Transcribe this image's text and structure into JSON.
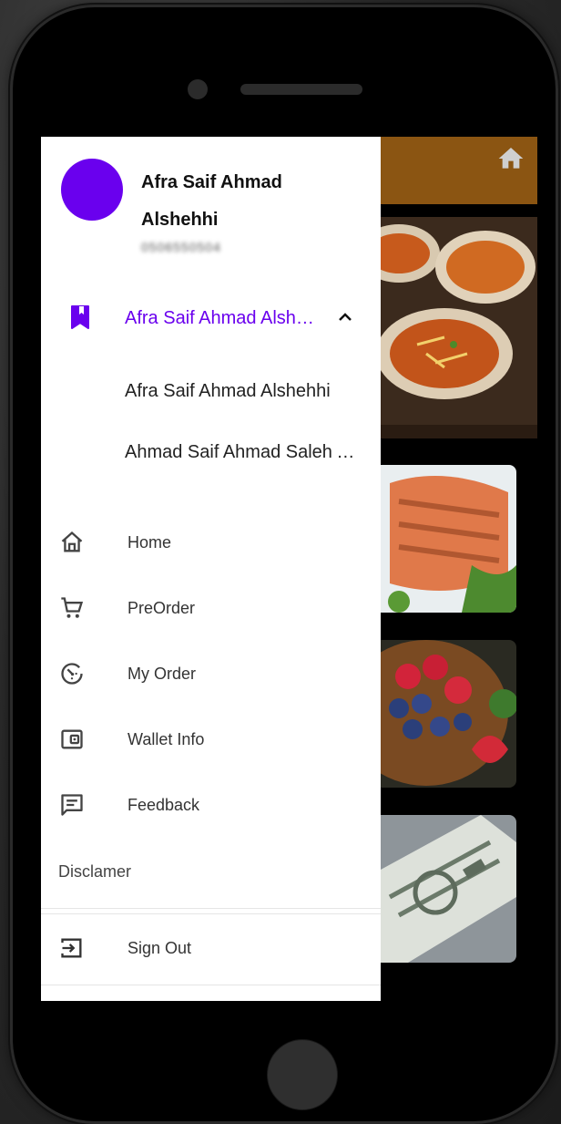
{
  "user": {
    "name": "Afra Saif Ahmad Alshehhi",
    "phone": "0506550504"
  },
  "account_selector": {
    "selected_label": "Afra Saif Ahmad Alshehhi",
    "icon": "bookmark-icon",
    "expanded": true,
    "options": [
      "Afra Saif Ahmad Alshehhi",
      "Ahmad Saif Ahmad Saleh Alshehhi"
    ]
  },
  "menu": [
    {
      "label": "Home",
      "icon": "home-outline-icon"
    },
    {
      "label": "PreOrder",
      "icon": "cart-icon"
    },
    {
      "label": "My Order",
      "icon": "timer-icon"
    },
    {
      "label": "Wallet Info",
      "icon": "wallet-icon"
    },
    {
      "label": "Feedback",
      "icon": "feedback-icon"
    }
  ],
  "disclaimer_label": "Disclamer",
  "sign_out_label": "Sign Out",
  "colors": {
    "accent": "#6a00ee",
    "app_bar": "#8b5512",
    "drawer_bg": "#ffffff"
  }
}
